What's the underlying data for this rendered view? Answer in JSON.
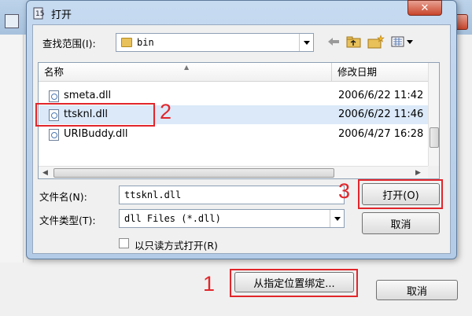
{
  "dialog": {
    "title": "打开",
    "close_glyph": "✕",
    "look_in_label": "查找范围(I):",
    "look_in_value": "bin",
    "toolbar_icons": [
      "back-arrow-icon",
      "up-folder-icon",
      "new-folder-icon",
      "view-menu-icon"
    ],
    "columns": [
      "名称",
      "修改日期"
    ],
    "files": [
      {
        "name": "smeta.dll",
        "date": "2006/6/22 11:42"
      },
      {
        "name": "ttsknl.dll",
        "date": "2006/6/22 11:46"
      },
      {
        "name": "URIBuddy.dll",
        "date": "2006/4/27 16:28"
      }
    ],
    "filename_label": "文件名(N):",
    "filename_value": "ttsknl.dll",
    "filetype_label": "文件类型(T):",
    "filetype_value": "dll Files (*.dll)",
    "readonly_label": "以只读方式打开(R)",
    "open_button": "打开(O)",
    "cancel_button": "取消"
  },
  "parent": {
    "bind_button": "从指定位置绑定...",
    "cancel_button": "取消"
  },
  "annotations": [
    "1",
    "2",
    "3"
  ],
  "colors": {
    "annotation": "#e1262b",
    "selection": "#dbe9f9",
    "title_bar": "#b9d1ea"
  }
}
